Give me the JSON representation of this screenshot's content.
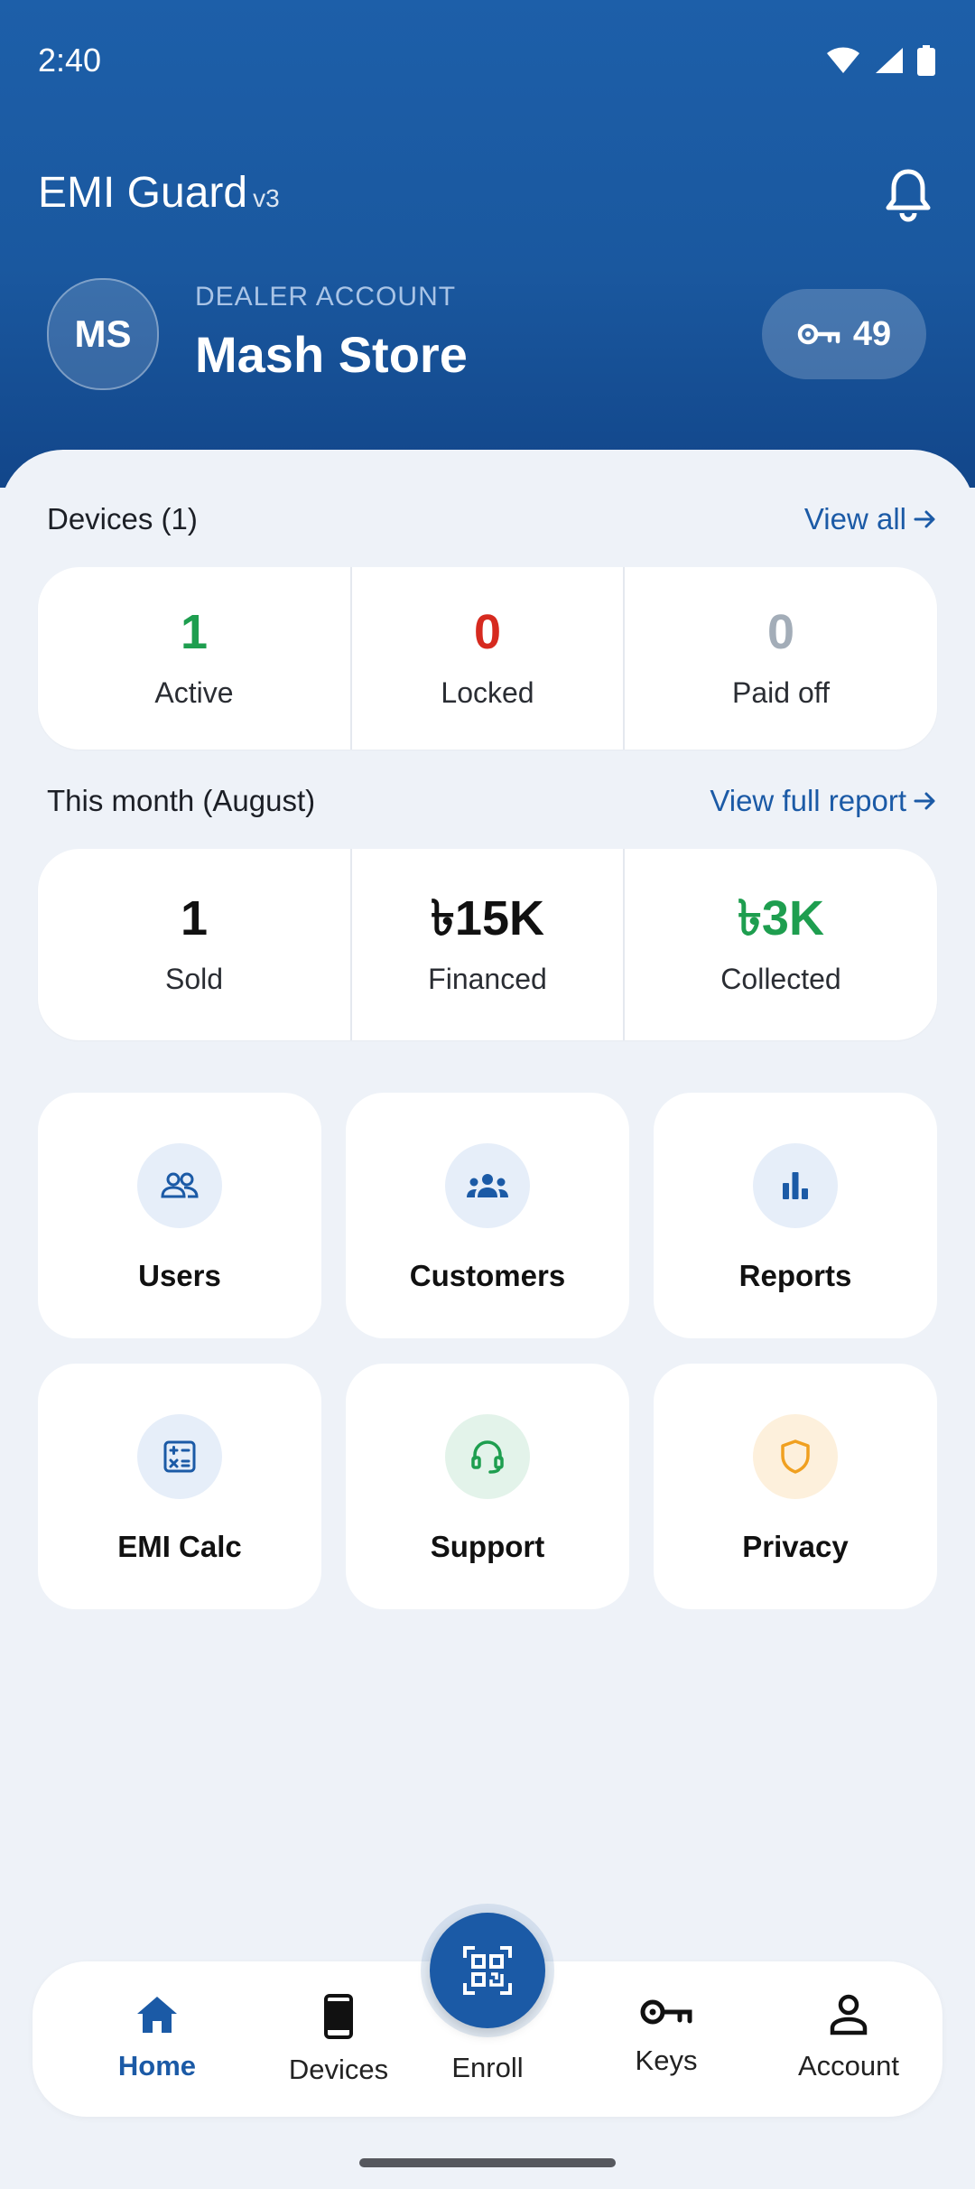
{
  "status_bar": {
    "time": "2:40"
  },
  "app": {
    "title": "EMI Guard",
    "version": "v3"
  },
  "dealer": {
    "initials": "MS",
    "label": "DEALER ACCOUNT",
    "name": "Mash Store",
    "keys_count": "49"
  },
  "devices_section": {
    "title": "Devices (1)",
    "link": "View all",
    "stats": [
      {
        "value": "1",
        "label": "Active",
        "color": "#1e9e4f"
      },
      {
        "value": "0",
        "label": "Locked",
        "color": "#d62a1f"
      },
      {
        "value": "0",
        "label": "Paid off",
        "color": "#a3adb8"
      }
    ]
  },
  "month_section": {
    "title": "This month (August)",
    "link": "View full report",
    "stats": [
      {
        "value": "1",
        "label": "Sold",
        "color": "#111111"
      },
      {
        "value": "৳15K",
        "label": "Financed",
        "color": "#111111"
      },
      {
        "value": "৳3K",
        "label": "Collected",
        "color": "#1e9e4f"
      }
    ]
  },
  "tiles": [
    {
      "label": "Users",
      "icon": "users-icon",
      "bg": "#e6eef9",
      "color": "#1b5aa6"
    },
    {
      "label": "Customers",
      "icon": "customers-icon",
      "bg": "#e6eef9",
      "color": "#1b5aa6"
    },
    {
      "label": "Reports",
      "icon": "bar-chart-icon",
      "bg": "#e6eef9",
      "color": "#1b5aa6"
    },
    {
      "label": "EMI Calc",
      "icon": "calculator-icon",
      "bg": "#e6eef9",
      "color": "#1b5aa6"
    },
    {
      "label": "Support",
      "icon": "headset-icon",
      "bg": "#e3f3ea",
      "color": "#1e9e4f"
    },
    {
      "label": "Privacy",
      "icon": "shield-icon",
      "bg": "#fdf0dc",
      "color": "#f0a020"
    }
  ],
  "nav": {
    "home": "Home",
    "devices": "Devices",
    "enroll": "Enroll",
    "keys": "Keys",
    "account": "Account",
    "active": "Home"
  },
  "colors": {
    "primary": "#1b5aa6",
    "header_bg": "#1a589f",
    "sheet_bg": "#eef2f8"
  }
}
